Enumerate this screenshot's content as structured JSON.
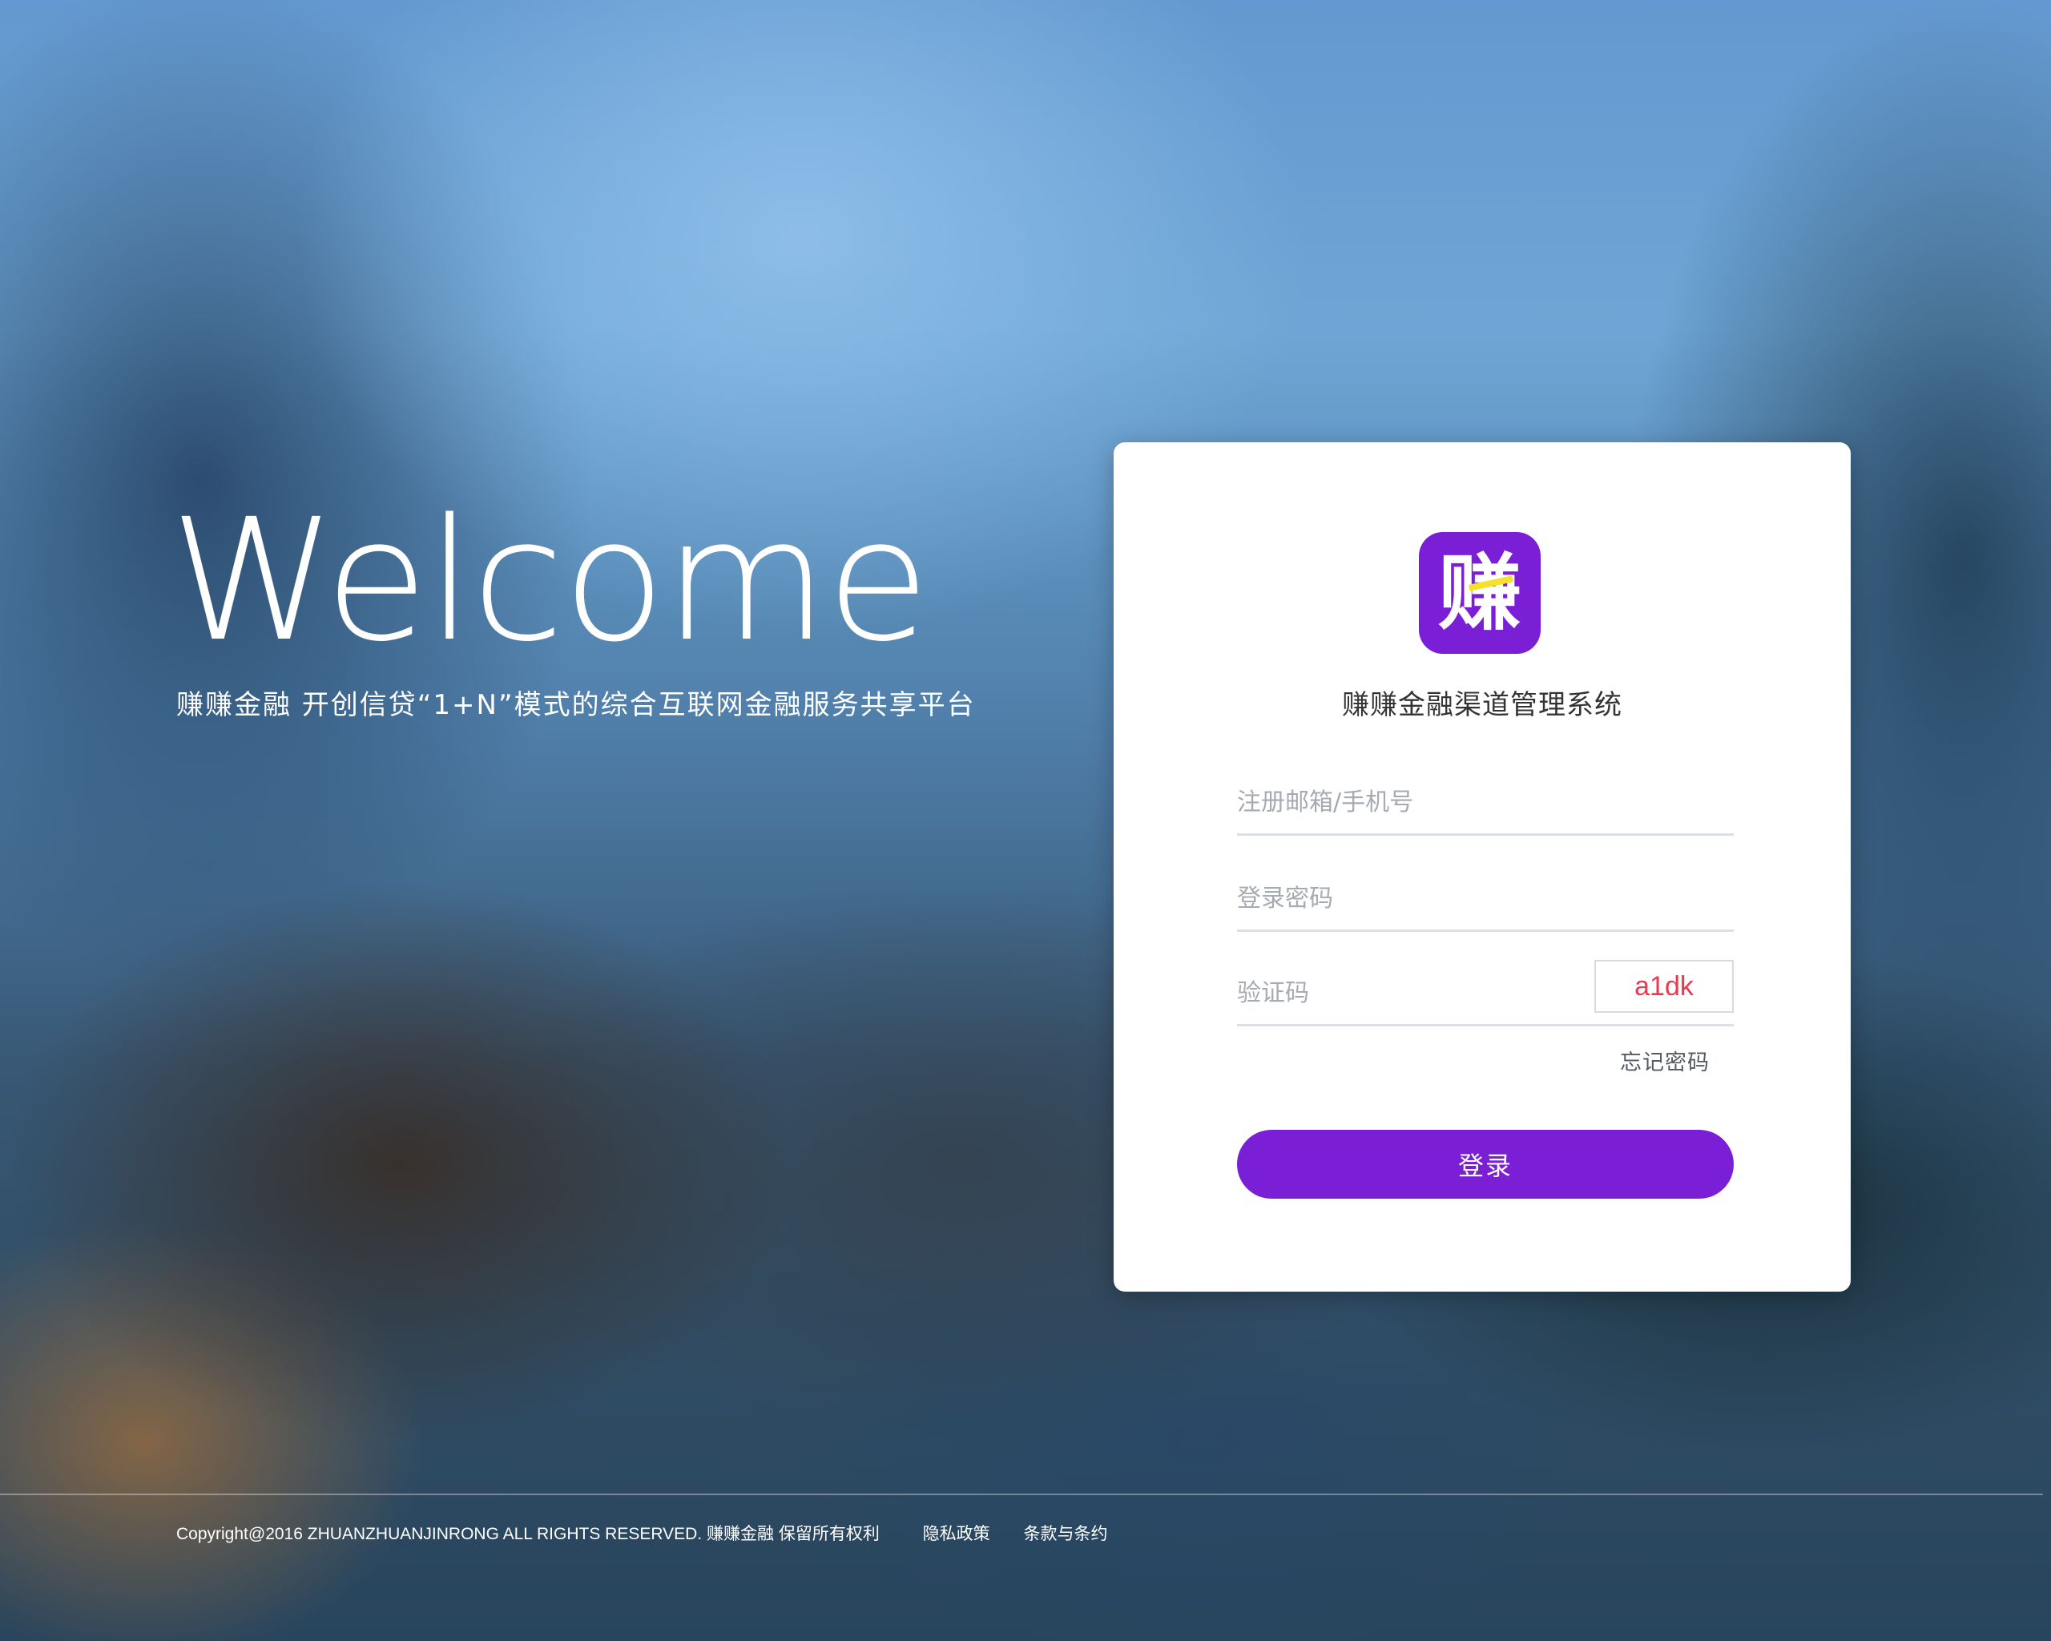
{
  "hero": {
    "welcome": "Welcome",
    "tagline": "赚赚金融  开创信贷“1+N”模式的综合互联网金融服务共享平台"
  },
  "login": {
    "logo_char": "赚",
    "title": "赚赚金融渠道管理系统",
    "account_placeholder": "注册邮箱/手机号",
    "password_placeholder": "登录密码",
    "captcha_placeholder": "验证码",
    "captcha_code": "a1dk",
    "forgot_password": "忘记密码",
    "submit_label": "登录",
    "brand_color": "#7b1fd6",
    "captcha_color": "#e83a4e"
  },
  "footer": {
    "copyright": "Copyright@2016 ZHUANZHUANJINRONG ALL RIGHTS RESERVED. 赚赚金融 保留所有权利",
    "privacy": "隐私政策",
    "terms": "条款与条约"
  }
}
